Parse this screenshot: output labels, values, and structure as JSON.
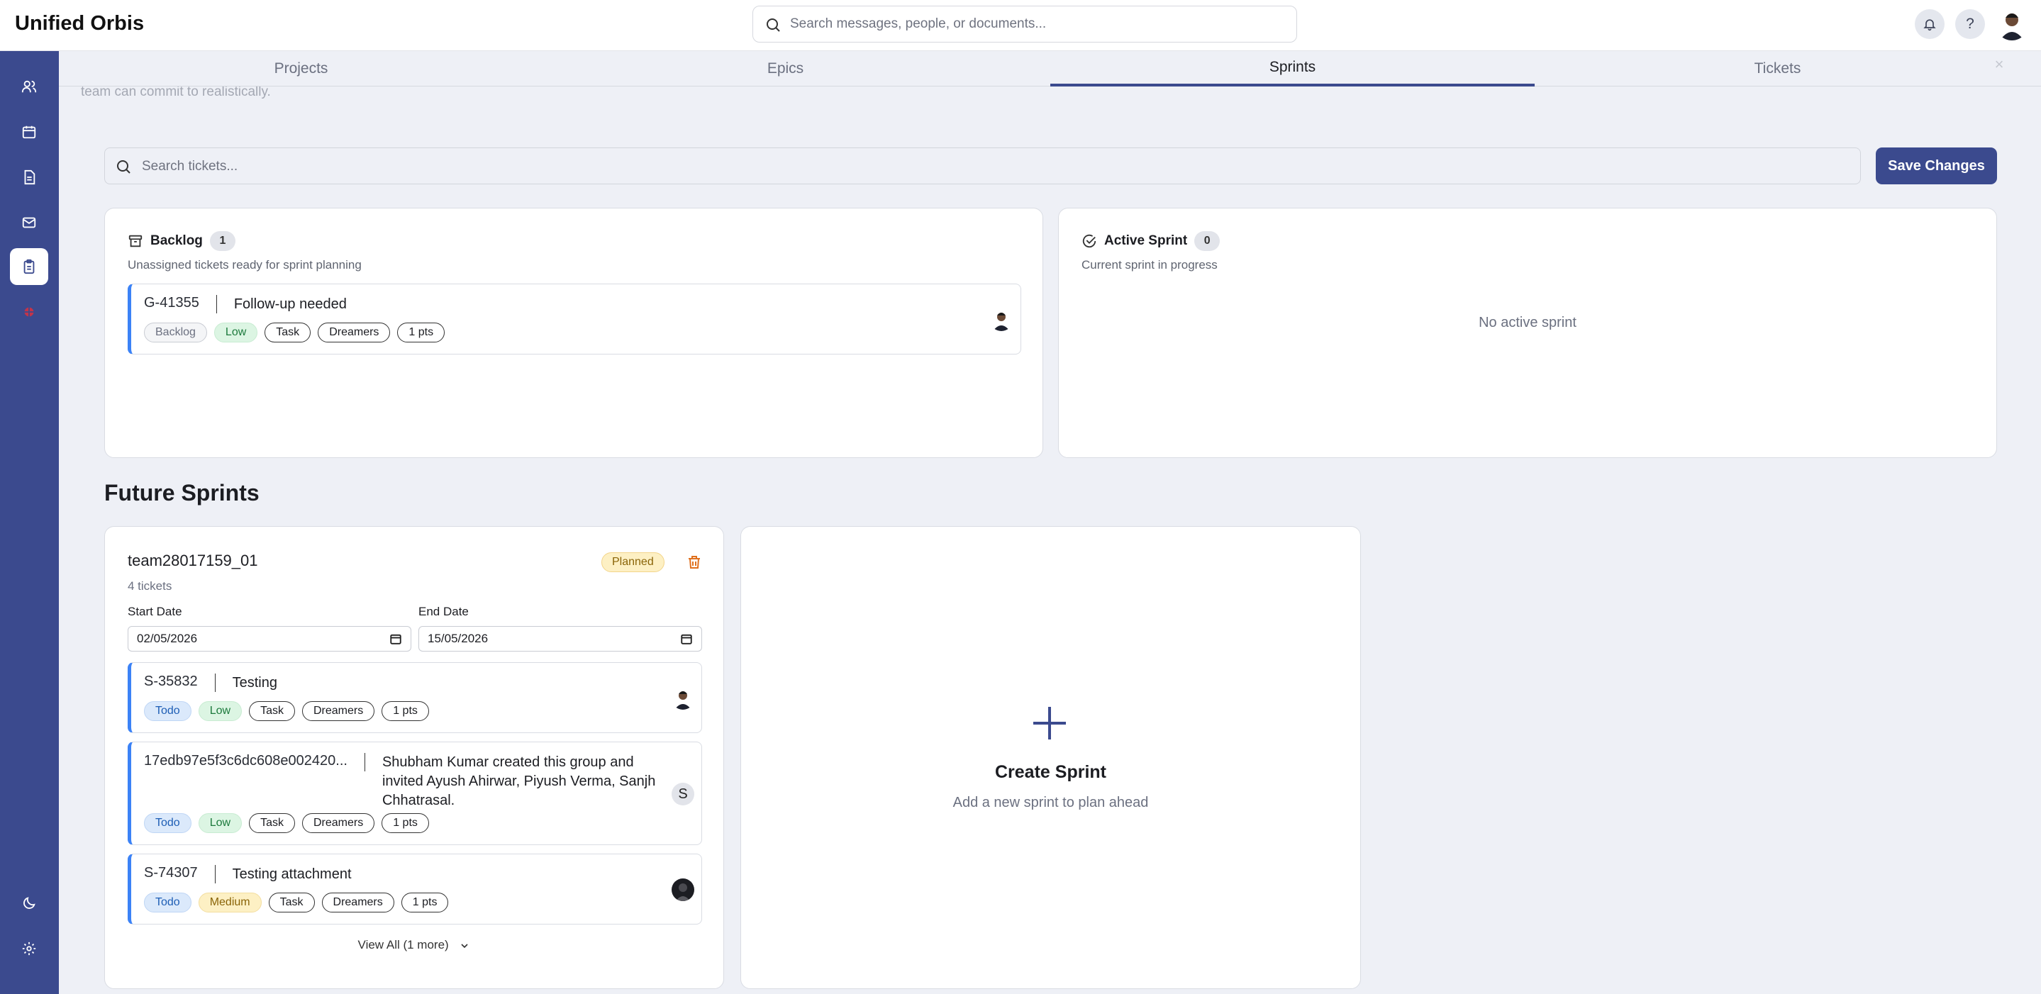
{
  "app": {
    "title": "Unified Orbis"
  },
  "global_search": {
    "placeholder": "Search messages, people, or documents..."
  },
  "tabs": [
    {
      "label": "Projects",
      "active": false
    },
    {
      "label": "Epics",
      "active": false
    },
    {
      "label": "Sprints",
      "active": true
    },
    {
      "label": "Tickets",
      "active": false
    }
  ],
  "background_text": "team can commit to realistically.",
  "ticket_search": {
    "placeholder": "Search tickets..."
  },
  "save_button": {
    "label": "Save Changes"
  },
  "backlog": {
    "title": "Backlog",
    "count": "1",
    "subtitle": "Unassigned tickets ready for sprint planning",
    "tickets": [
      {
        "id": "G-41355",
        "title": "Follow-up needed",
        "status": "Backlog",
        "priority": "Low",
        "type": "Task",
        "team": "Dreamers",
        "points": "1 pts"
      }
    ]
  },
  "active_sprint": {
    "title": "Active Sprint",
    "count": "0",
    "subtitle": "Current sprint in progress",
    "empty_text": "No active sprint"
  },
  "future_sprints": {
    "heading": "Future Sprints",
    "sprints": [
      {
        "name": "team28017159_01",
        "ticket_count": "4 tickets",
        "status": "Planned",
        "start_label": "Start Date",
        "end_label": "End Date",
        "start_date": "02/05/2026",
        "end_date": "15/05/2026",
        "tickets": [
          {
            "id": "S-35832",
            "title": "Testing",
            "status": "Todo",
            "priority": "Low",
            "type": "Task",
            "team": "Dreamers",
            "points": "1 pts"
          },
          {
            "id": "17edb97e5f3c6dc608e002420...",
            "title": "Shubham Kumar created this group and invited Ayush Ahirwar, Piyush Verma, Sanjh Chhatrasal.",
            "status": "Todo",
            "priority": "Low",
            "type": "Task",
            "team": "Dreamers",
            "points": "1 pts",
            "avatar_letter": "S"
          },
          {
            "id": "S-74307",
            "title": "Testing attachment",
            "status": "Todo",
            "priority": "Medium",
            "type": "Task",
            "team": "Dreamers",
            "points": "1 pts"
          }
        ],
        "view_all": "View All (1 more)"
      }
    ],
    "create": {
      "title": "Create Sprint",
      "subtitle": "Add a new sprint to plan ahead"
    }
  },
  "colors": {
    "brand": "#3b4a8e",
    "ticket_accent": "#3b82f6"
  }
}
